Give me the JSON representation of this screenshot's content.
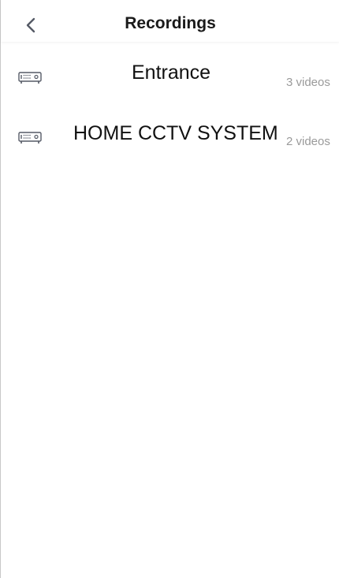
{
  "header": {
    "title": "Recordings",
    "back_icon": "chevron-left-icon"
  },
  "recordings": [
    {
      "name": "Entrance",
      "count": "3 videos",
      "icon": "dvr-recorder-icon"
    },
    {
      "name": "HOME CCTV SYSTEM",
      "count": "2 videos",
      "icon": "dvr-recorder-icon"
    }
  ],
  "colors": {
    "accent": "#555a66",
    "subtext": "#9a9a9a",
    "title": "#1a1a1a"
  }
}
